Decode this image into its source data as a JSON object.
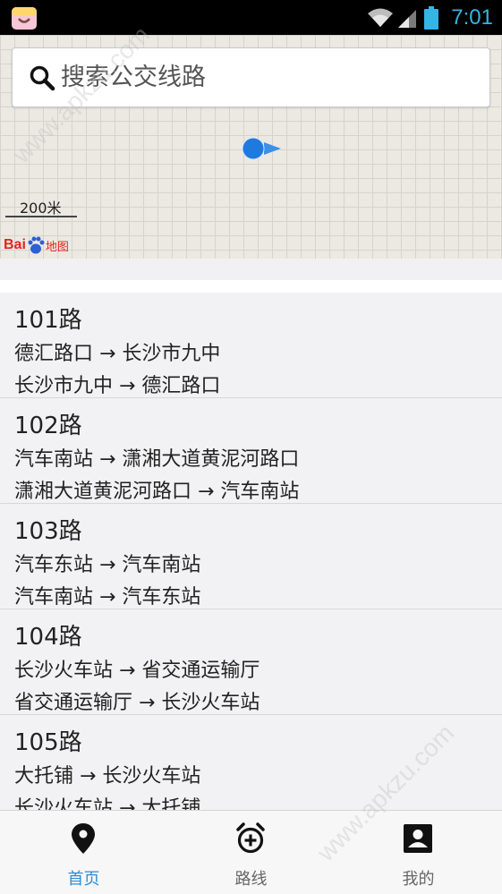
{
  "status_bar": {
    "time": "7:01",
    "icons": [
      "app-icon",
      "wifi-icon",
      "signal-icon",
      "battery-icon"
    ]
  },
  "map": {
    "search_placeholder": "搜索公交线路",
    "scale_label": "200米",
    "logo": {
      "bai": "Bai",
      "du": "地图"
    }
  },
  "routes": [
    {
      "name": "101路",
      "dir1": "德汇路口 → 长沙市九中",
      "dir2": "长沙市九中 → 德汇路口"
    },
    {
      "name": "102路",
      "dir1": "汽车南站 → 潇湘大道黄泥河路口",
      "dir2": "潇湘大道黄泥河路口 → 汽车南站"
    },
    {
      "name": "103路",
      "dir1": "汽车东站 → 汽车南站",
      "dir2": "汽车南站 → 汽车东站"
    },
    {
      "name": "104路",
      "dir1": "长沙火车站 → 省交通运输厅",
      "dir2": "省交通运输厅 → 长沙火车站"
    },
    {
      "name": "105路",
      "dir1": "大托铺 → 长沙火车站",
      "dir2": "长沙火车站 → 大托铺"
    }
  ],
  "nav": {
    "home": "首页",
    "routes": "路线",
    "mine": "我的"
  },
  "colors": {
    "accent": "#2a8ed8",
    "status_blue": "#33b5e5",
    "map_bg": "#ece9e3",
    "list_bg": "#f2f2f4"
  },
  "watermark": "www.apkzu.com"
}
